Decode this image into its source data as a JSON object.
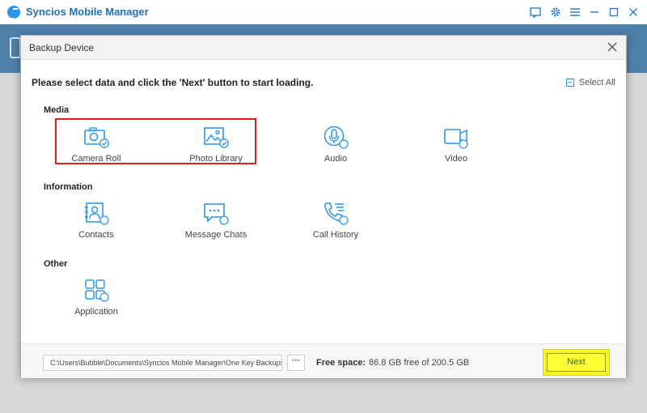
{
  "app": {
    "title": "Syncios Mobile Manager"
  },
  "dialog": {
    "title": "Backup Device",
    "instruction": "Please select data and click the 'Next' button to start loading.",
    "select_all": "Select All",
    "sections": {
      "media": {
        "label": "Media",
        "items": [
          {
            "label": "Camera Roll",
            "icon": "camera-icon",
            "state": "checked"
          },
          {
            "label": "Photo Library",
            "icon": "photo-icon",
            "state": "checked"
          },
          {
            "label": "Audio",
            "icon": "microphone-icon",
            "state": "unchecked"
          },
          {
            "label": "Video",
            "icon": "video-icon",
            "state": "unchecked"
          }
        ]
      },
      "information": {
        "label": "Information",
        "items": [
          {
            "label": "Contacts",
            "icon": "contacts-icon",
            "state": "unchecked"
          },
          {
            "label": "Message Chats",
            "icon": "message-icon",
            "state": "unchecked"
          },
          {
            "label": "Call History",
            "icon": "phone-icon",
            "state": "unchecked"
          }
        ]
      },
      "other": {
        "label": "Other",
        "items": [
          {
            "label": "Application",
            "icon": "apps-icon",
            "state": "unchecked"
          }
        ]
      }
    },
    "footer": {
      "path": "C:\\Users\\Bubble\\Documents\\Syncios Mobile Manager\\One Key Backups",
      "browse_label": "···",
      "free_space_label": "Free space:",
      "free_space_value": "86.8 GB free of 200.5 GB",
      "next_label": "Next"
    }
  },
  "colors": {
    "accent": "#2d95e8",
    "highlight_red": "#e0201c",
    "highlight_yellow": "#ffff33"
  }
}
